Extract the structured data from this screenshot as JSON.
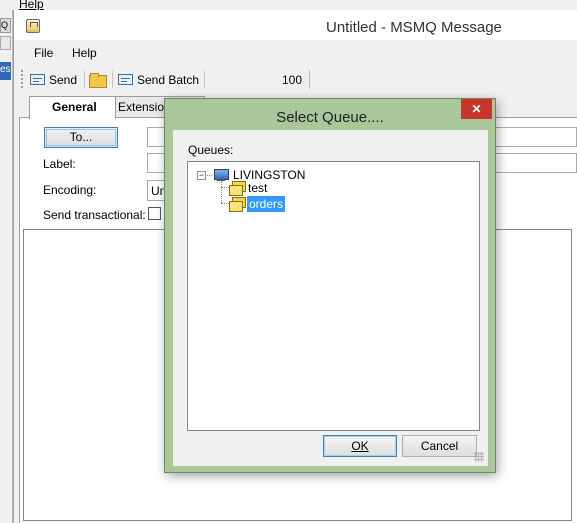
{
  "background_app": {
    "menu_help": "Help",
    "tab_fragment_1": "Q E",
    "tab_fragment_3": "es"
  },
  "window": {
    "title": "Untitled - MSMQ Message"
  },
  "menubar": {
    "file": "File",
    "help": "Help"
  },
  "toolbar": {
    "send_label": "Send",
    "send_batch_label": "Send Batch",
    "batch_count": "100"
  },
  "tabs": [
    {
      "label": "General",
      "active": true
    },
    {
      "label": "Extension",
      "active": false
    }
  ],
  "form": {
    "to_button": "To...",
    "label_caption": "Label:",
    "encoding_caption": "Encoding:",
    "encoding_value": "Un",
    "send_transactional_caption": "Send transactional:",
    "send_transactional_checked": false
  },
  "dialog": {
    "title": "Select Queue....",
    "close_glyph": "✕",
    "queues_caption": "Queues:",
    "tree": {
      "root": "LIVINGSTON",
      "children": [
        {
          "label": "test",
          "selected": false
        },
        {
          "label": "orders",
          "selected": true
        }
      ]
    },
    "ok_label": "OK",
    "cancel_label": "Cancel"
  }
}
